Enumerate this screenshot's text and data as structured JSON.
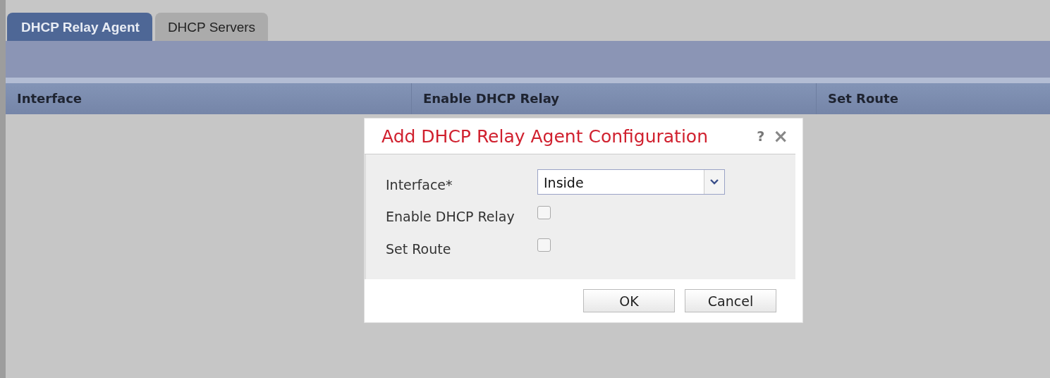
{
  "tabs": [
    {
      "label": "DHCP Relay Agent",
      "selected": true
    },
    {
      "label": "DHCP Servers",
      "selected": false
    }
  ],
  "table": {
    "columns": [
      "Interface",
      "Enable DHCP Relay",
      "Set Route"
    ]
  },
  "dialog": {
    "title": "Add DHCP Relay Agent Configuration",
    "help": "?",
    "close": "×",
    "fields": [
      {
        "kind": "select",
        "label": "Interface*",
        "value": "Inside"
      },
      {
        "kind": "checkbox",
        "label": "Enable DHCP Relay",
        "checked": false
      },
      {
        "kind": "checkbox",
        "label": "Set Route",
        "checked": false
      }
    ],
    "buttons": [
      "OK",
      "Cancel"
    ]
  }
}
